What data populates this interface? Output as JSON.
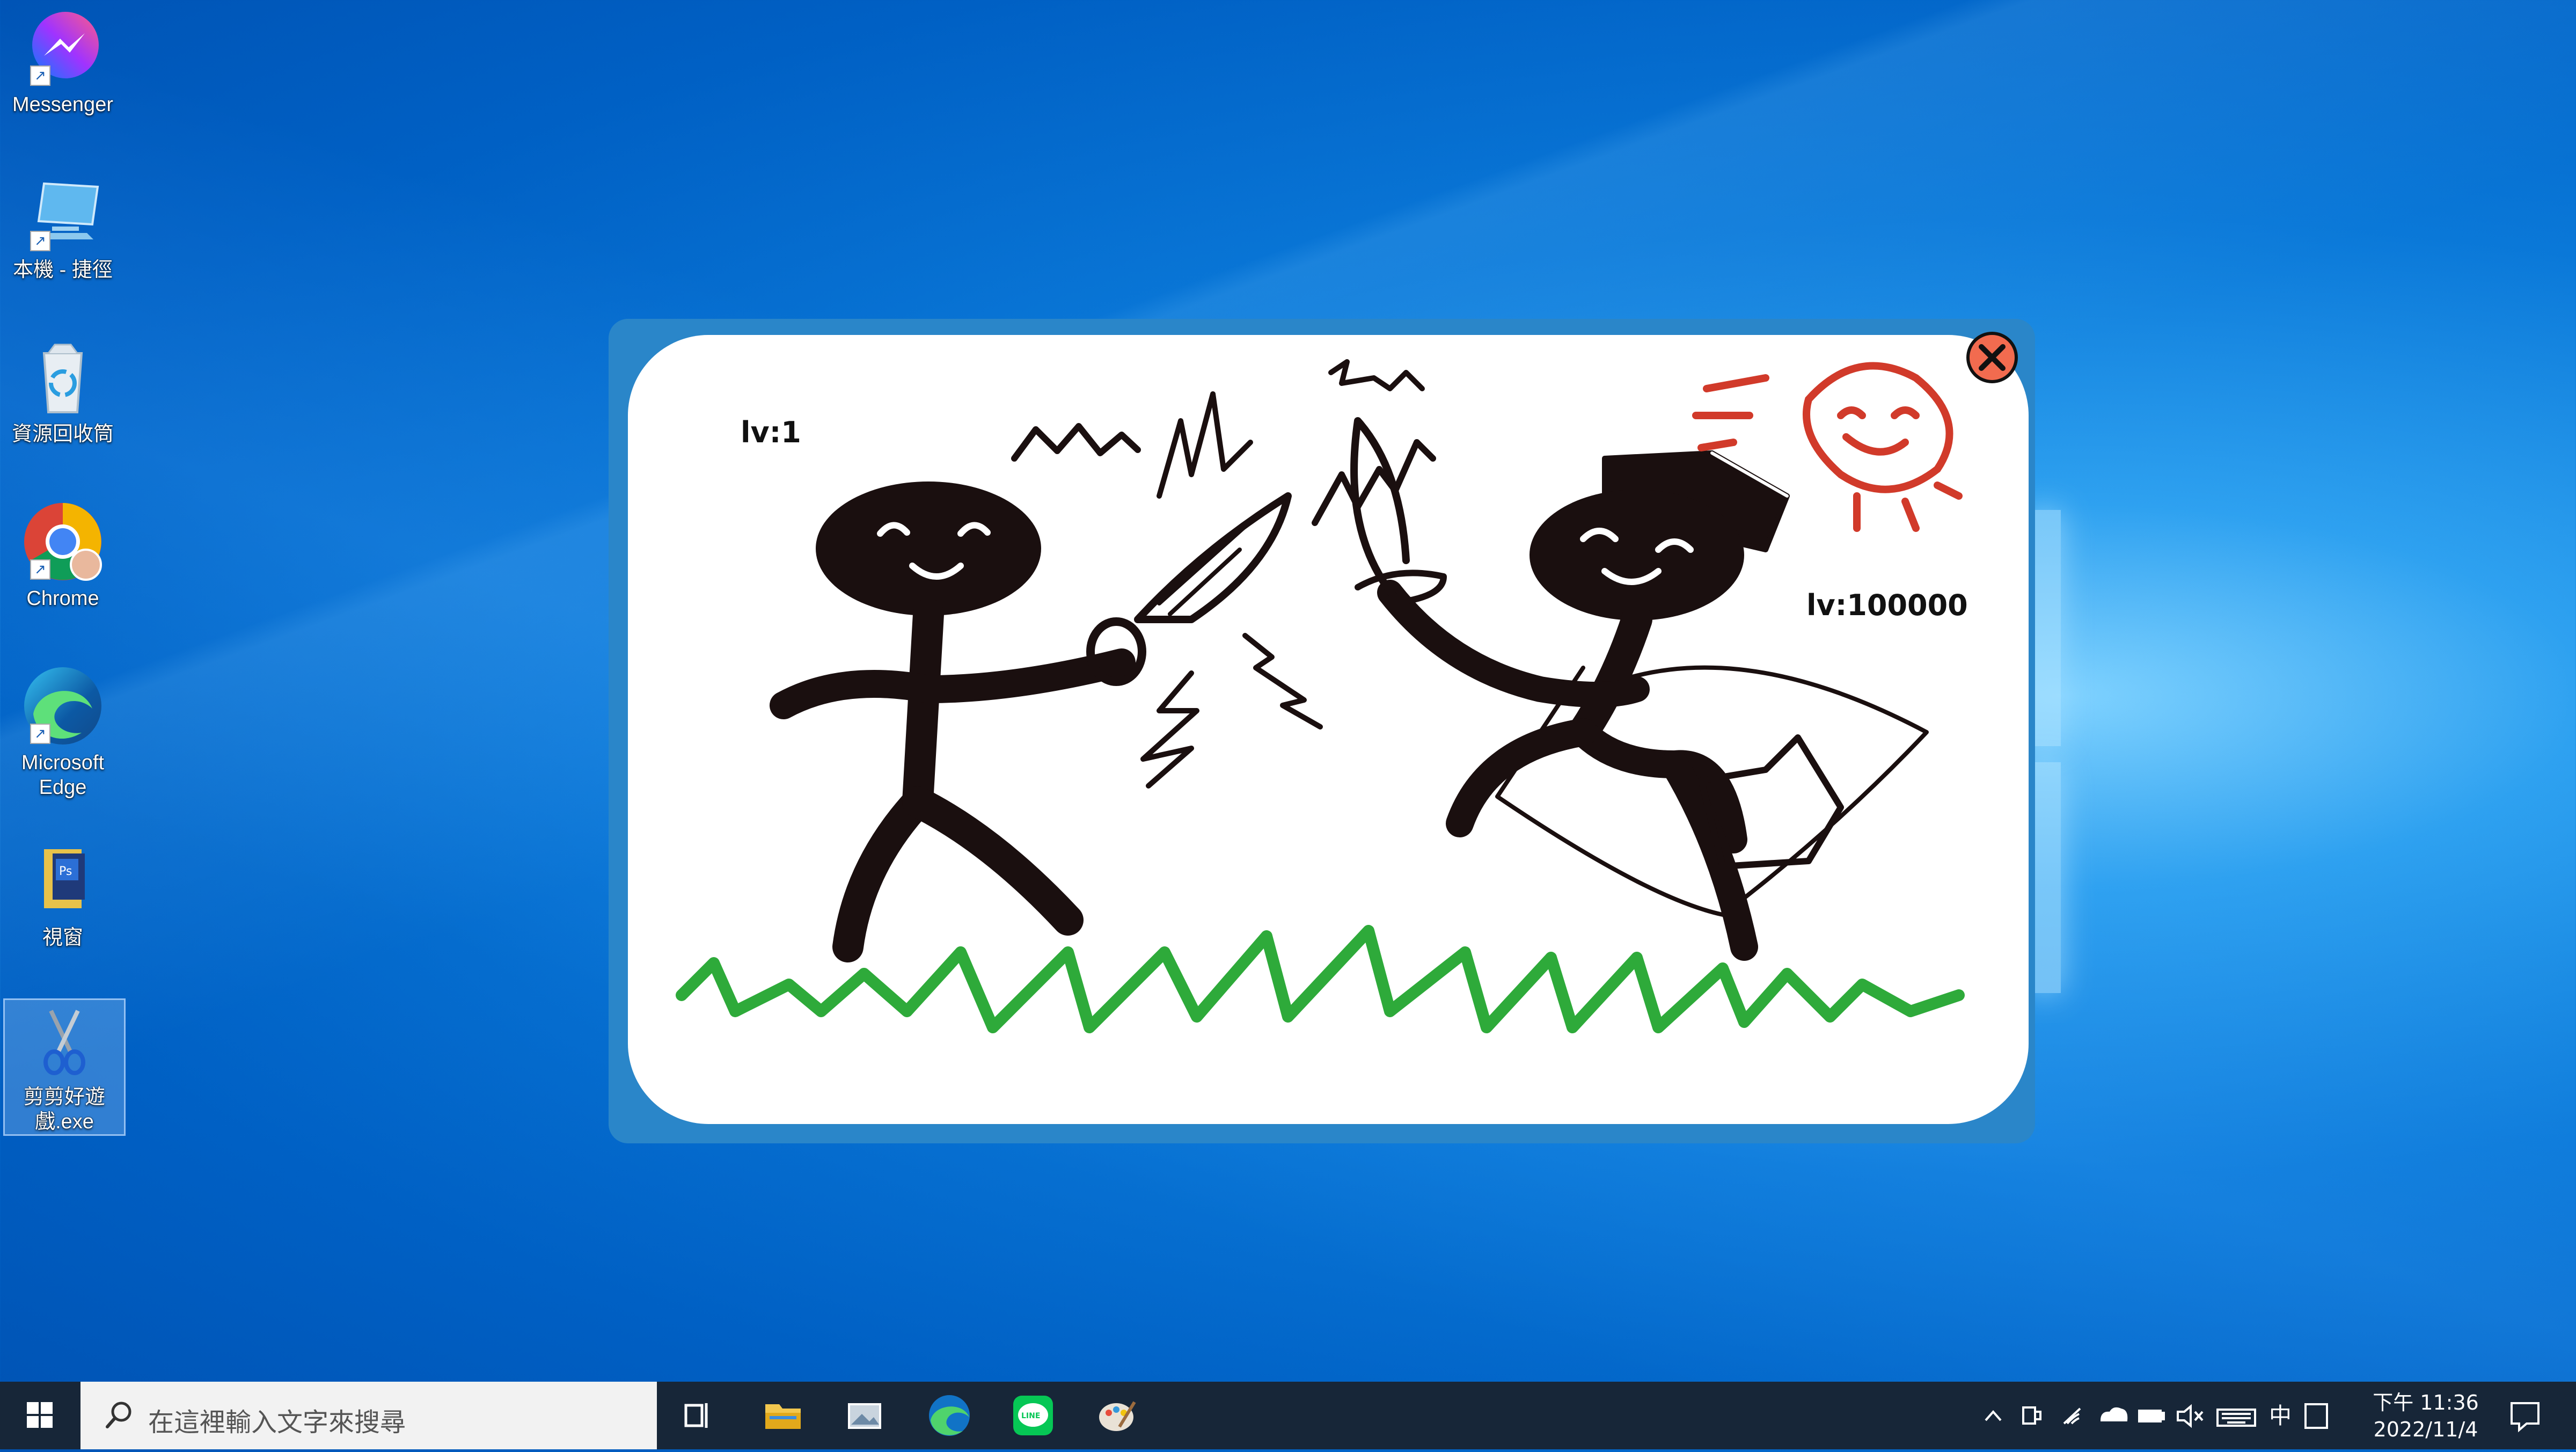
{
  "desktop": {
    "icons": [
      {
        "label": "Messenger"
      },
      {
        "label": "本機 - 捷徑"
      },
      {
        "label": "資源回收筒"
      },
      {
        "label": "Chrome"
      },
      {
        "label": "Microsoft Edge"
      },
      {
        "label": "視窗"
      },
      {
        "label": "剪剪好遊戲.exe"
      }
    ]
  },
  "game": {
    "player_level": "lv:1",
    "enemy_level": "lv:100000"
  },
  "taskbar": {
    "search_placeholder": "在這裡輸入文字來搜尋",
    "ime": "中",
    "time_line1": "下午 11:36",
    "time_line2": "2022/11/4"
  },
  "colors": {
    "window_frame": "#2a86c9",
    "close_button": "#f26b4f",
    "grass": "#2eaa3a",
    "sun": "#d13a2a",
    "taskbar": "#172638"
  }
}
